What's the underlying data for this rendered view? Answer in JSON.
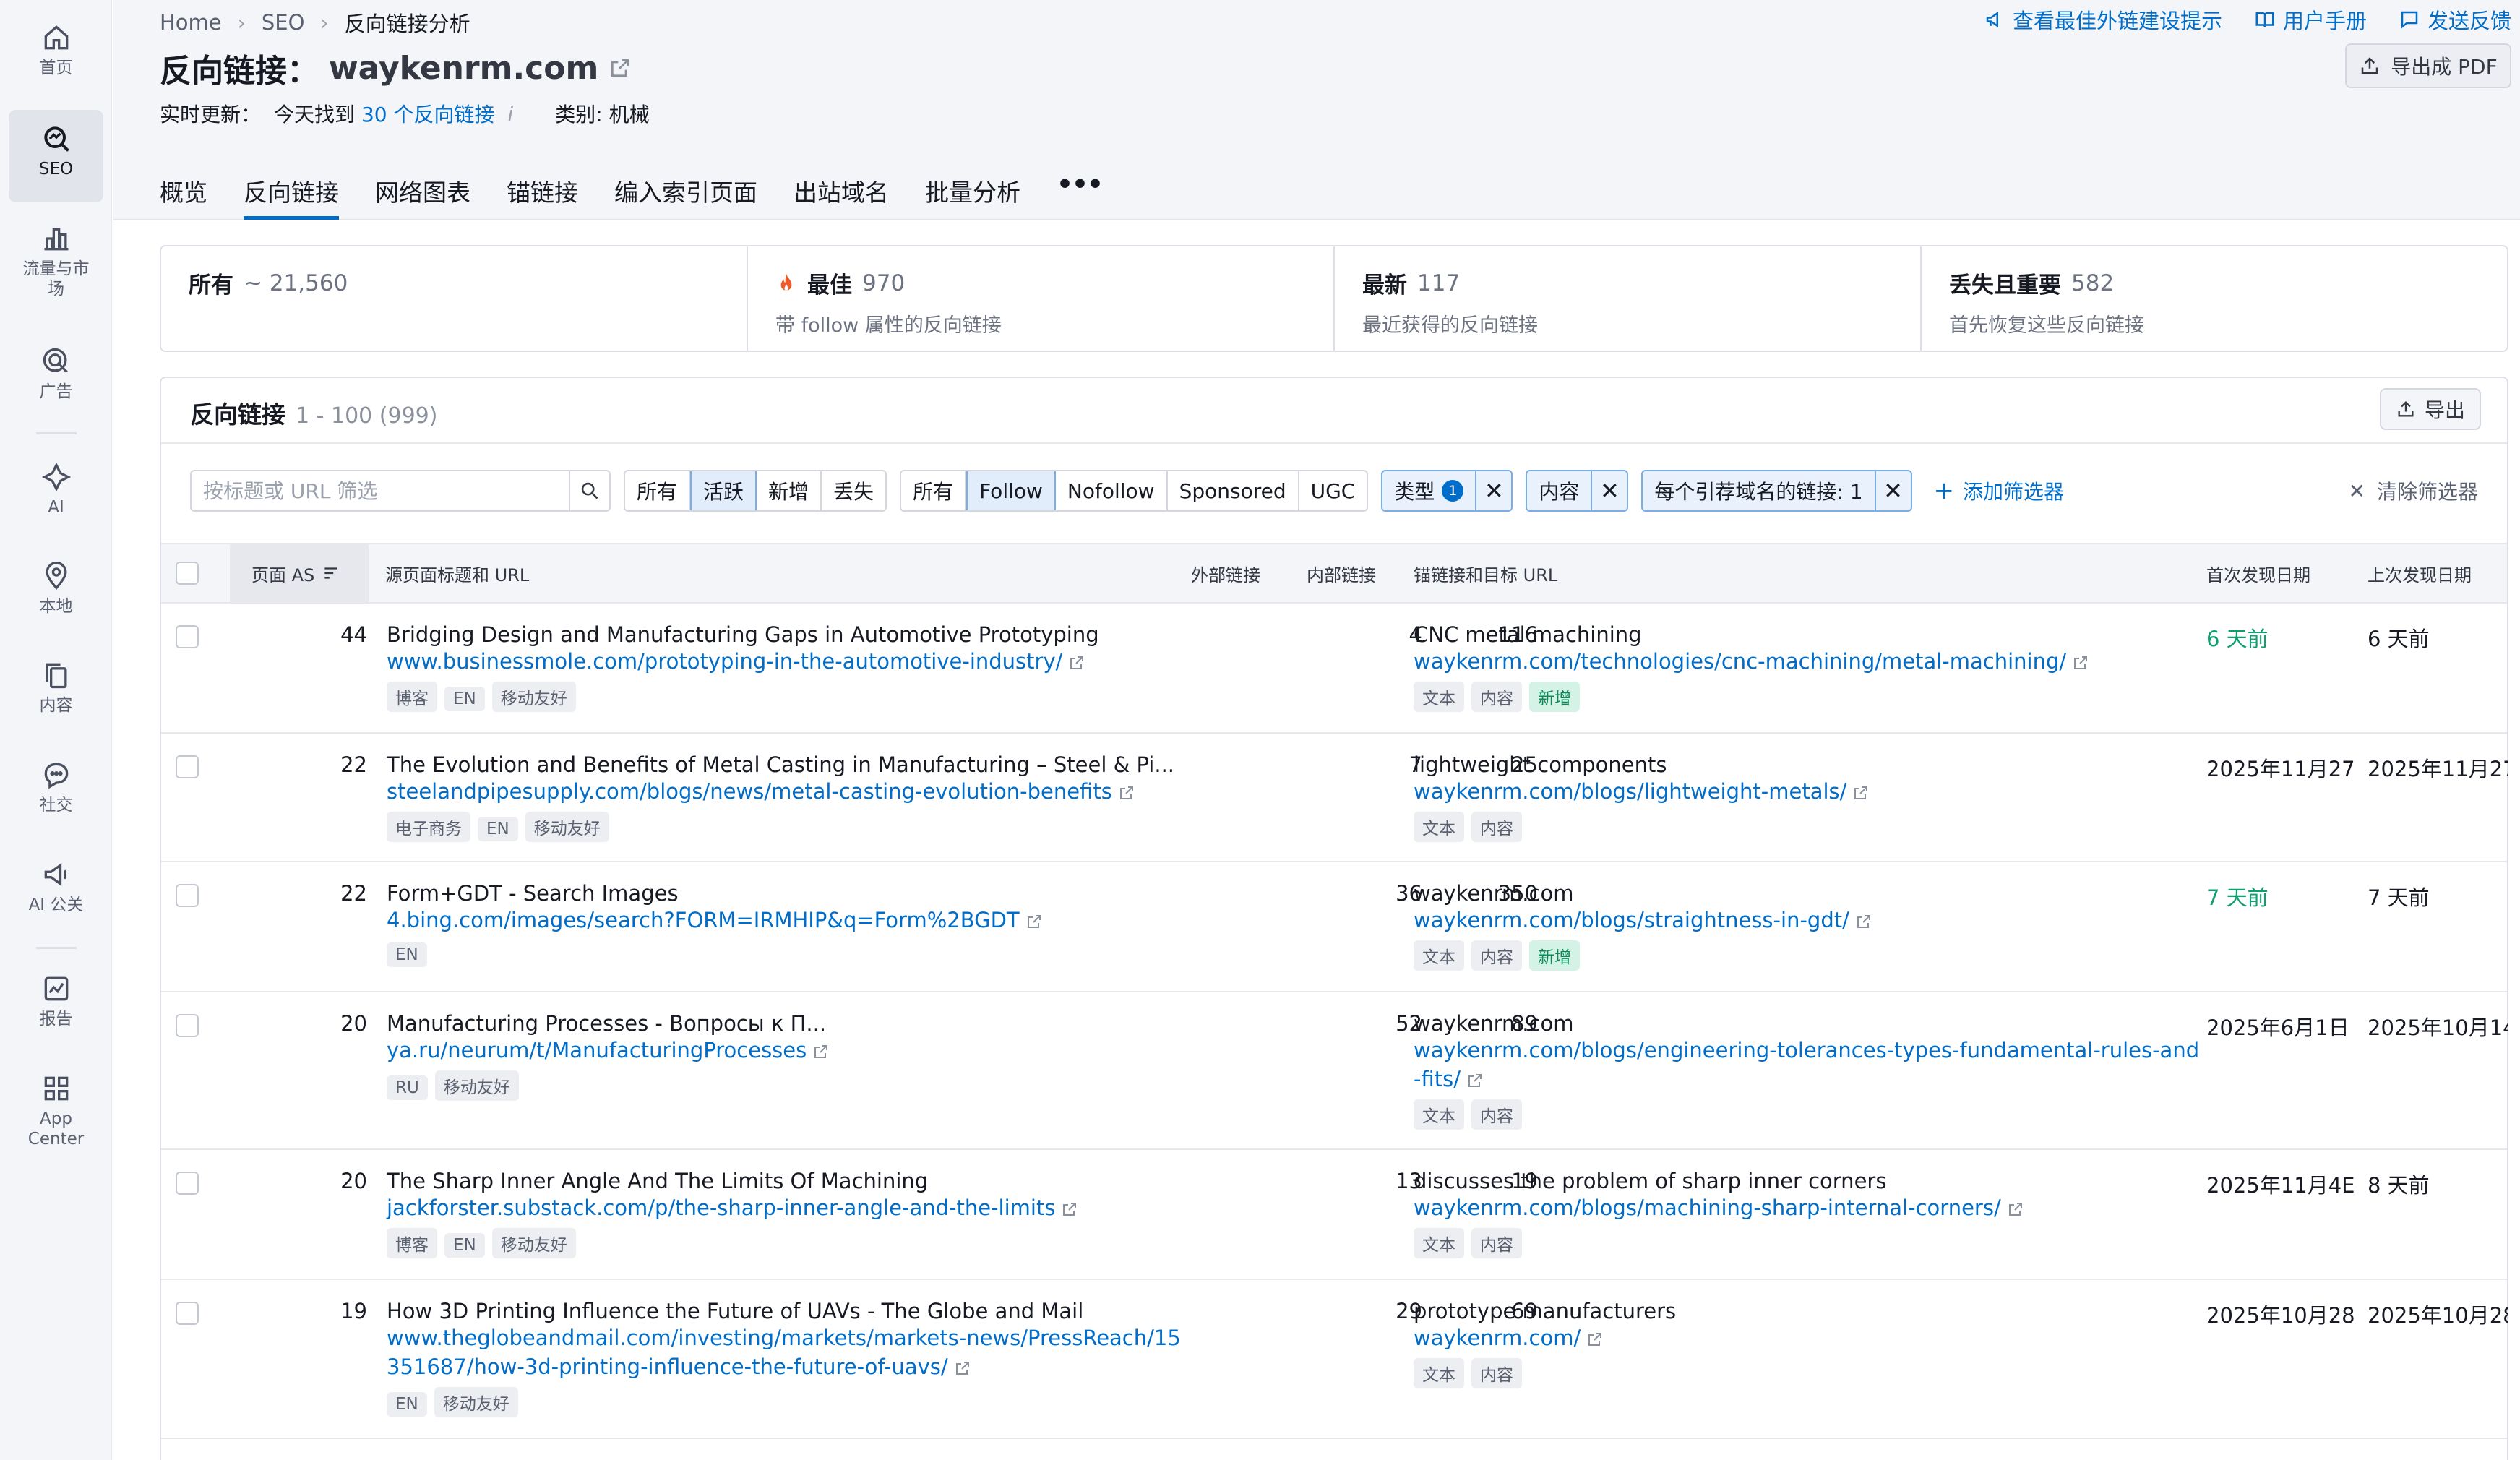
{
  "sidebar": {
    "items": [
      {
        "label": "首页",
        "icon": "home-icon"
      },
      {
        "label": "SEO",
        "icon": "seo-icon",
        "active": true
      },
      {
        "label": "流量与市场",
        "icon": "traffic-market-icon"
      },
      {
        "label": "广告",
        "icon": "advertising-icon"
      },
      {
        "label": "AI",
        "icon": "ai-icon"
      },
      {
        "label": "本地",
        "icon": "local-pin-icon"
      },
      {
        "label": "内容",
        "icon": "content-icon"
      },
      {
        "label": "社交",
        "icon": "social-chat-icon"
      },
      {
        "label": "AI 公关",
        "icon": "ai-pr-megaphone-icon"
      },
      {
        "label": "报告",
        "icon": "report-icon"
      },
      {
        "label": "App Center",
        "icon": "app-center-grid-icon"
      }
    ]
  },
  "breadcrumb": [
    "Home",
    "SEO",
    "反向链接分析"
  ],
  "top_links": [
    "查看最佳外链建设提示",
    "用户手册",
    "发送反馈"
  ],
  "title": {
    "label": "反向链接：",
    "domain": "waykenrm.com"
  },
  "subtitle": {
    "prefix": "实时更新：",
    "found_text": "今天找到",
    "found_link": "30 个反向链接",
    "category": "类别: 机械"
  },
  "export_pdf": "导出成 PDF",
  "tabs": [
    "概览",
    "反向链接",
    "网络图表",
    "锚链接",
    "编入索引页面",
    "出站域名",
    "批量分析"
  ],
  "tabs_more": "•••",
  "cards": [
    {
      "title": "所有",
      "count": "~ 21,560",
      "sub": ""
    },
    {
      "title": "最佳",
      "count": "970",
      "sub": "带 follow 属性的反向链接"
    },
    {
      "title": "最新",
      "count": "117",
      "sub": "最近获得的反向链接"
    },
    {
      "title": "丢失且重要",
      "count": "582",
      "sub": "首先恢复这些反向链接"
    }
  ],
  "panel": {
    "title": "反向链接",
    "range": "1 - 100 (999)",
    "export": "导出"
  },
  "filters": {
    "search_placeholder": "按标题或 URL 筛选",
    "status_seg": [
      "所有",
      "活跃",
      "新增",
      "丢失"
    ],
    "status_active": "活跃",
    "type_seg": [
      "所有",
      "Follow",
      "Nofollow",
      "Sponsored",
      "UGC"
    ],
    "type_active": "Follow",
    "chips": [
      {
        "label": "类型",
        "badge": "1"
      },
      {
        "label": "内容"
      },
      {
        "label": "每个引荐域名的链接: 1"
      }
    ],
    "add_filter": "添加筛选器",
    "clear_filter": "清除筛选器"
  },
  "table": {
    "headers": {
      "as": "页面 AS",
      "source": "源页面标题和 URL",
      "external": "外部链接",
      "internal": "内部链接",
      "anchor": "锚链接和目标 URL",
      "first_seen": "首次发现日期",
      "last_seen": "上次发现日期"
    },
    "rows": [
      {
        "as": "44",
        "title": "Bridging Design and Manufacturing Gaps in Automotive Prototyping",
        "url": "www.businessmole.com/prototyping-in-the-automotive-industry/",
        "tags": [
          "博客",
          "EN",
          "移动友好"
        ],
        "external": "4",
        "internal": "116",
        "anchor": "CNC metal machining",
        "target": "waykenrm.com/technologies/cnc-machining/metal-machining/",
        "anchor_tags": [
          "文本",
          "内容"
        ],
        "anchor_new": "新增",
        "first_seen": "6 天前",
        "first_green": true,
        "last_seen": "6 天前"
      },
      {
        "as": "22",
        "title": "The Evolution and Benefits of Metal Casting in Manufacturing – Steel & Pi...",
        "url": "steelandpipesupply.com/blogs/news/metal-casting-evolution-benefits",
        "tags": [
          "电子商务",
          "EN",
          "移动友好"
        ],
        "external": "7",
        "internal": "25",
        "anchor": "lightweight components",
        "target": "waykenrm.com/blogs/lightweight-metals/",
        "anchor_tags": [
          "文本",
          "内容"
        ],
        "anchor_new": "",
        "first_seen": "2025年11月27",
        "first_green": false,
        "last_seen": "2025年11月27"
      },
      {
        "as": "22",
        "title": "Form+GDT - Search Images",
        "url": "4.bing.com/images/search?FORM=IRMHIP&q=Form%2BGDT",
        "tags": [
          "EN"
        ],
        "external": "36",
        "internal": "350",
        "anchor": "waykenrm.com",
        "target": "waykenrm.com/blogs/straightness-in-gdt/",
        "anchor_tags": [
          "文本",
          "内容"
        ],
        "anchor_new": "新增",
        "first_seen": "7 天前",
        "first_green": true,
        "last_seen": "7 天前"
      },
      {
        "as": "20",
        "title": "Manufacturing Processes - Вопросы к П...",
        "url": "ya.ru/neurum/t/ManufacturingProcesses",
        "tags": [
          "RU",
          "移动友好"
        ],
        "external": "52",
        "internal": "89",
        "anchor": "waykenrm.com",
        "target": "waykenrm.com/blogs/engineering-tolerances-types-fundamental-rules-and",
        "target2": "-fits/",
        "anchor_tags": [
          "文本",
          "内容"
        ],
        "anchor_new": "",
        "first_seen": "2025年6月1日",
        "first_green": false,
        "last_seen": "2025年10月14"
      },
      {
        "as": "20",
        "title": "The Sharp Inner Angle And The Limits Of Machining",
        "url": "jackforster.substack.com/p/the-sharp-inner-angle-and-the-limits",
        "tags": [
          "博客",
          "EN",
          "移动友好"
        ],
        "external": "13",
        "internal": "19",
        "anchor": "discusses the problem of sharp inner corners",
        "target": "waykenrm.com/blogs/machining-sharp-internal-corners/",
        "anchor_tags": [
          "文本",
          "内容"
        ],
        "anchor_new": "",
        "first_seen": "2025年11月4E",
        "first_green": false,
        "last_seen": "8 天前"
      },
      {
        "as": "19",
        "title": "How 3D Printing Influence the Future of UAVs - The Globe and Mail",
        "url": "www.theglobeandmail.com/investing/markets/markets-news/PressReach/15",
        "url2": "351687/how-3d-printing-influence-the-future-of-uavs/",
        "tags": [
          "EN",
          "移动友好"
        ],
        "external": "29",
        "internal": "69",
        "anchor": "prototype manufacturers",
        "target": "waykenrm.com/",
        "anchor_tags": [
          "文本",
          "内容"
        ],
        "anchor_new": "",
        "first_seen": "2025年10月28",
        "first_green": false,
        "last_seen": "2025年10月28"
      }
    ]
  },
  "colors": {
    "accent": "#006dca",
    "green": "#0d9f6e",
    "fire": "#f0592a"
  }
}
